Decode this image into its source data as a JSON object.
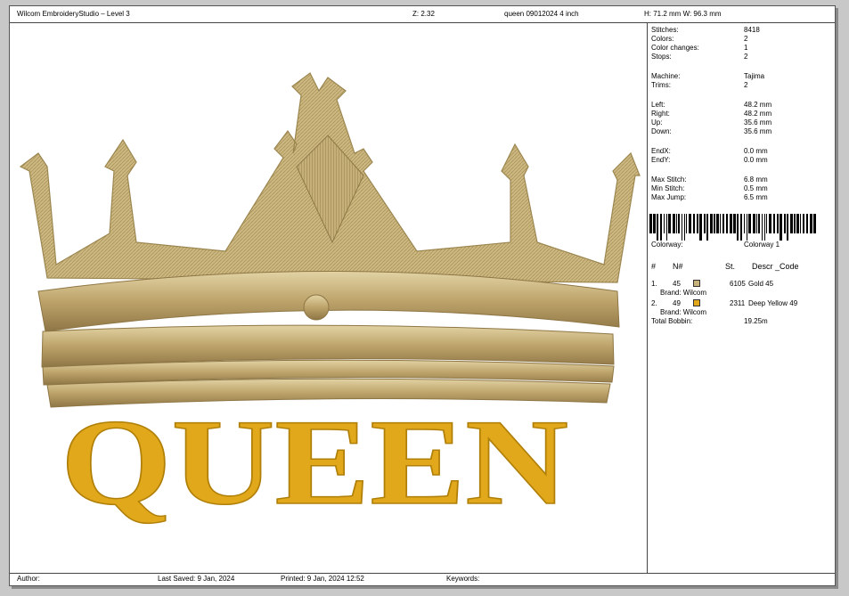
{
  "header": {
    "app_title": "Wilcom EmbroideryStudio – Level 3",
    "zoom": "Z: 2.32",
    "design_name": "queen 09012024 4 inch",
    "size": "H: 71.2 mm   W: 96.3 mm"
  },
  "stats": [
    {
      "label": "Stitches:",
      "value": "8418"
    },
    {
      "label": "Colors:",
      "value": "2"
    },
    {
      "label": "Color changes:",
      "value": "1"
    },
    {
      "label": "Stops:",
      "value": "2"
    },
    {
      "label": "Machine:",
      "value": "Tajima"
    },
    {
      "label": "Trims:",
      "value": "2"
    },
    {
      "label": "Left:",
      "value": "48.2 mm"
    },
    {
      "label": "Right:",
      "value": "48.2 mm"
    },
    {
      "label": "Up:",
      "value": "35.6 mm"
    },
    {
      "label": "Down:",
      "value": "35.6 mm"
    },
    {
      "label": "EndX:",
      "value": "0.0 mm"
    },
    {
      "label": "EndY:",
      "value": "0.0 mm"
    },
    {
      "label": "Max Stitch:",
      "value": "6.8 mm"
    },
    {
      "label": "Min Stitch:",
      "value": "0.5 mm"
    },
    {
      "label": "Max Jump:",
      "value": "6.5 mm"
    }
  ],
  "colorway": {
    "label": "Colorway:",
    "value": "Colorway 1"
  },
  "color_table": {
    "headers": {
      "index": "#",
      "num": "N#",
      "stitches": "St.",
      "descr": "Descr _Code"
    },
    "rows": [
      {
        "index": "1.",
        "num": "45",
        "color": "#c9b27a",
        "stitches": "6105",
        "descr": "Gold 45",
        "brand": "Brand: Wilcom"
      },
      {
        "index": "2.",
        "num": "49",
        "color": "#e0a81a",
        "stitches": "2311",
        "descr": "Deep Yellow 49",
        "brand": "Brand: Wilcom"
      }
    ],
    "bobbin_label": "Total Bobbin:",
    "bobbin_value": "19.25m"
  },
  "footer": {
    "author": "Author:",
    "last_saved": "Last Saved:  9 Jan, 2024",
    "printed": "Printed:  9 Jan, 2024 12:52",
    "keywords": "Keywords:"
  },
  "design": {
    "text": "QUEEN",
    "crown_color": "#c9b27a",
    "text_color": "#e0a81a"
  }
}
